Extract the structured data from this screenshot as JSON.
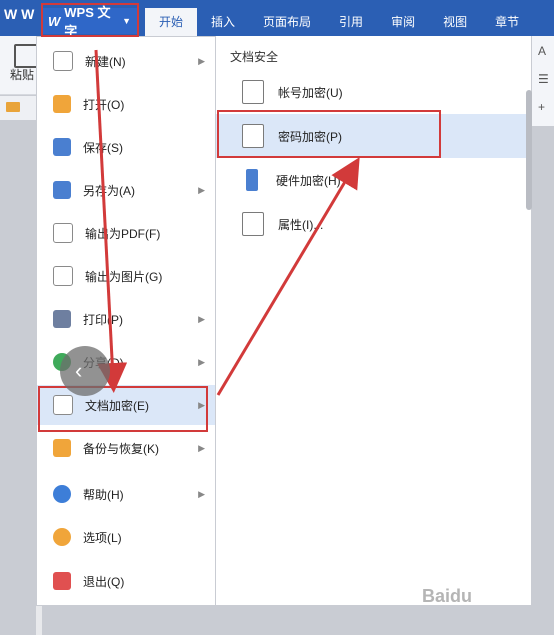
{
  "app": {
    "title_fragment": "W W",
    "wps_button": "WPS 文字"
  },
  "tabs": [
    "开始",
    "插入",
    "页面布局",
    "引用",
    "审阅",
    "视图",
    "章节"
  ],
  "ribbon": {
    "paste_label": "粘贴"
  },
  "menu": {
    "items": [
      {
        "label": "新建(N)",
        "icon": "new-doc-icon",
        "has_arrow": true
      },
      {
        "label": "打开(O)",
        "icon": "open-folder-icon",
        "has_arrow": false
      },
      {
        "label": "保存(S)",
        "icon": "save-icon",
        "has_arrow": false
      },
      {
        "label": "另存为(A)",
        "icon": "save-as-icon",
        "has_arrow": true
      },
      {
        "label": "输出为PDF(F)",
        "icon": "pdf-export-icon",
        "has_arrow": false
      },
      {
        "label": "输出为图片(G)",
        "icon": "image-export-icon",
        "has_arrow": false
      },
      {
        "label": "打印(P)",
        "icon": "print-icon",
        "has_arrow": true
      },
      {
        "label": "分享(D)",
        "icon": "share-icon",
        "has_arrow": true
      },
      {
        "label": "文档加密(E)",
        "icon": "doc-encrypt-icon",
        "has_arrow": true
      },
      {
        "label": "备份与恢复(K)",
        "icon": "backup-icon",
        "has_arrow": true
      },
      {
        "label": "帮助(H)",
        "icon": "help-icon",
        "has_arrow": true
      },
      {
        "label": "选项(L)",
        "icon": "options-icon",
        "has_arrow": false
      },
      {
        "label": "退出(Q)",
        "icon": "exit-icon",
        "has_arrow": false
      }
    ]
  },
  "submenu": {
    "title": "文档安全",
    "items": [
      {
        "label": "帐号加密(U)",
        "icon": "account-lock-icon"
      },
      {
        "label": "密码加密(P)",
        "icon": "password-lock-icon"
      },
      {
        "label": "硬件加密(H)",
        "icon": "usb-key-icon"
      },
      {
        "label": "属性(I)...",
        "icon": "properties-icon"
      }
    ]
  },
  "colors": {
    "titlebar": "#2b5fb4",
    "highlight_box": "#d23a3a",
    "selected_bg": "#dbe7f8"
  }
}
